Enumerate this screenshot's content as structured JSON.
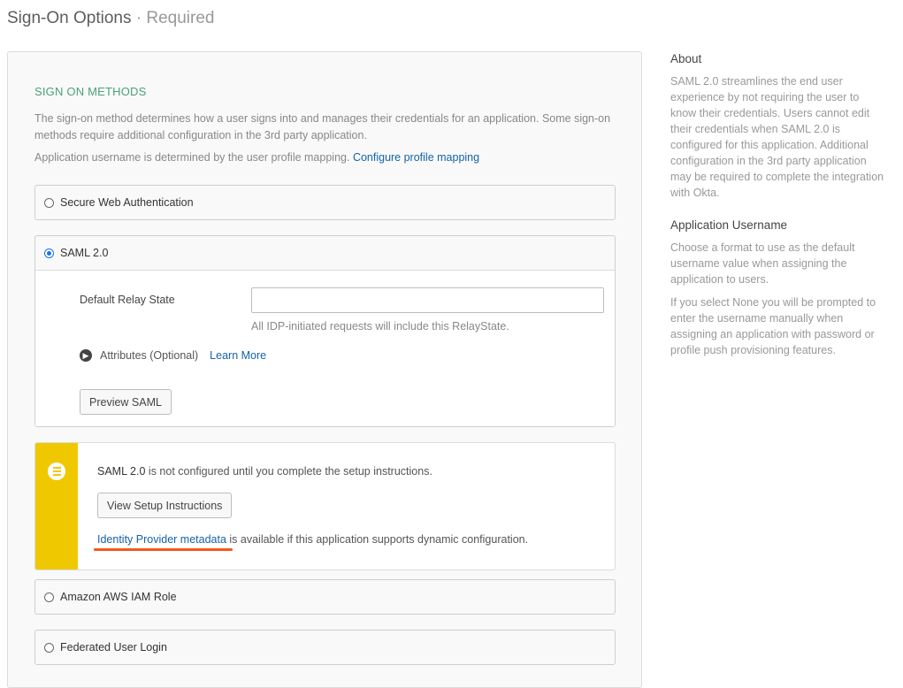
{
  "header": {
    "title": "Sign-On Options",
    "separator": "·",
    "subtitle": "Required"
  },
  "section": {
    "heading": "SIGN ON METHODS",
    "description": "The sign-on method determines how a user signs into and manages their credentials for an application. Some sign-on methods require additional configuration in the 3rd party application.",
    "username_note": "Application username is determined by the user profile mapping.",
    "profile_link": "Configure profile mapping"
  },
  "methods": {
    "swa": {
      "label": "Secure Web Authentication",
      "selected": false
    },
    "saml": {
      "label": "SAML 2.0",
      "selected": true
    },
    "aws": {
      "label": "Amazon AWS IAM Role",
      "selected": false
    },
    "federated": {
      "label": "Federated User Login",
      "selected": false
    }
  },
  "saml_config": {
    "relay_label": "Default Relay State",
    "relay_value": "",
    "relay_hint": "All IDP-initiated requests will include this RelayState.",
    "attributes_label": "Attributes (Optional)",
    "learn_more": "Learn More",
    "preview_button": "Preview SAML"
  },
  "callout": {
    "saml_name": "SAML 2.0",
    "message": " is not configured until you complete the setup instructions.",
    "setup_button": "View Setup Instructions",
    "metadata_link": "Identity Provider metadata",
    "metadata_text": " is available if this application supports dynamic configuration.",
    "accent_color": "#f0c800",
    "highlight_color": "#f05a1e"
  },
  "sidebar": {
    "about_title": "About",
    "about_text": "SAML 2.0 streamlines the end user experience by not requiring the user to know their credentials. Users cannot edit their credentials when SAML 2.0 is configured for this application. Additional configuration in the 3rd party application may be required to complete the integration with Okta.",
    "username_title": "Application Username",
    "username_text1": "Choose a format to use as the default username value when assigning the application to users.",
    "username_text2": "If you select None you will be prompted to enter the username manually when assigning an application with password or profile push provisioning features."
  },
  "icons": {
    "expand": "chevron-right-icon",
    "callout": "list-icon"
  }
}
